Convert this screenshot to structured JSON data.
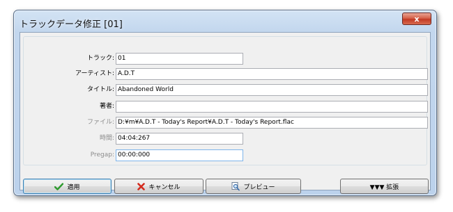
{
  "window": {
    "title": "トラックデータ修正 [01]",
    "close_glyph": "x"
  },
  "form": {
    "track": {
      "label": "トラック:",
      "value": "01"
    },
    "artist": {
      "label": "アーティスト:",
      "value": "A.D.T"
    },
    "title": {
      "label": "タイトル:",
      "value": "Abandoned World"
    },
    "author": {
      "label": "著者:",
      "value": ""
    },
    "file": {
      "label": "ファイル:",
      "value": "D:¥m¥A.D.T - Today's Report¥A.D.T - Today's Report.flac"
    },
    "time": {
      "label": "時間:",
      "value": "04:04:267"
    },
    "pregap": {
      "label": "Pregap:",
      "value": "00:00:000"
    }
  },
  "buttons": {
    "apply": "適用",
    "cancel": "キャンセル",
    "preview": "プレビュー",
    "expand": "▼▼▼ 拡張"
  },
  "colors": {
    "apply_check": "#2e9a2e",
    "cancel_x": "#d42b1e",
    "titlebar": "#c3d7ee"
  }
}
